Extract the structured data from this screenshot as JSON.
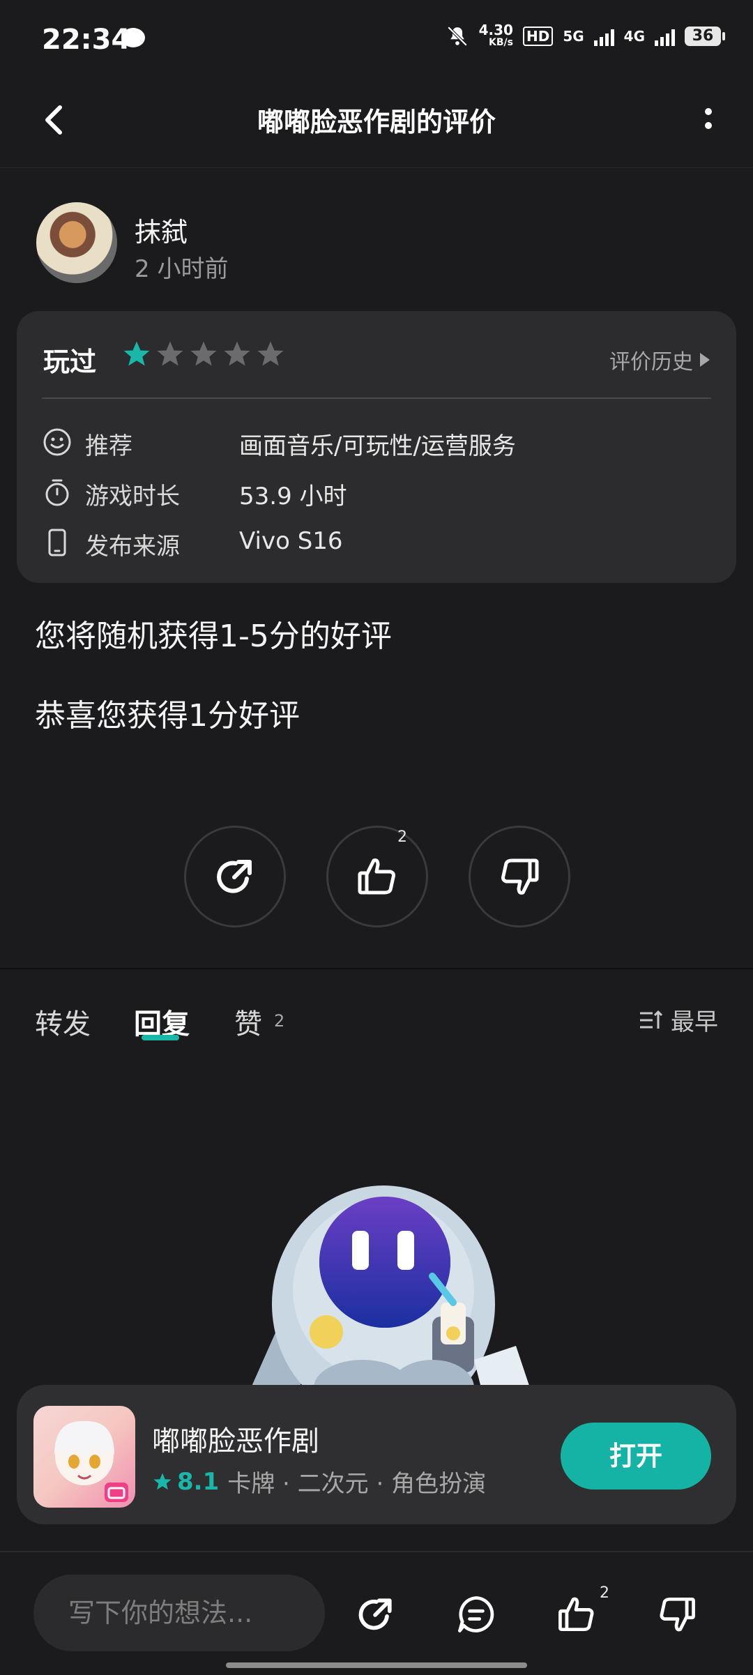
{
  "status_bar": {
    "time": "22:34",
    "net_speed": "4.30",
    "net_unit": "KB/s",
    "hd_label": "HD",
    "sim1": "5G",
    "sim2": "4G",
    "battery": "36"
  },
  "header": {
    "title": "嘟嘟脸恶作剧的评价"
  },
  "user": {
    "name": "抹弑",
    "time": "2 小时前"
  },
  "review": {
    "status": "玩过",
    "stars_filled": 1,
    "stars_total": 5,
    "history_label": "评价历史",
    "rows": [
      {
        "label": "推荐",
        "value": "画面音乐/可玩性/运营服务",
        "icon": "smiley-icon"
      },
      {
        "label": "游戏时长",
        "value": "53.9 小时",
        "icon": "stopwatch-icon"
      },
      {
        "label": "发布来源",
        "value": "Vivo S16",
        "icon": "phone-icon"
      }
    ]
  },
  "content": {
    "line1": "您将随机获得1-5分的好评",
    "line2": "恭喜您获得1分好评"
  },
  "actions": {
    "like_count": "2"
  },
  "tabs": {
    "items": [
      "转发",
      "回复",
      "赞"
    ],
    "active": "回复",
    "like_count": "2",
    "sort_label": "最早"
  },
  "app_card": {
    "name": "嘟嘟脸恶作剧",
    "rating": "8.1",
    "tags": "卡牌 · 二次元 · 角色扮演",
    "open_label": "打开"
  },
  "bottom_bar": {
    "placeholder": "写下你的想法...",
    "like_count": "2"
  },
  "colors": {
    "accent": "#19b7aa",
    "background": "#1b1b1d",
    "card": "#2c2c2e"
  }
}
